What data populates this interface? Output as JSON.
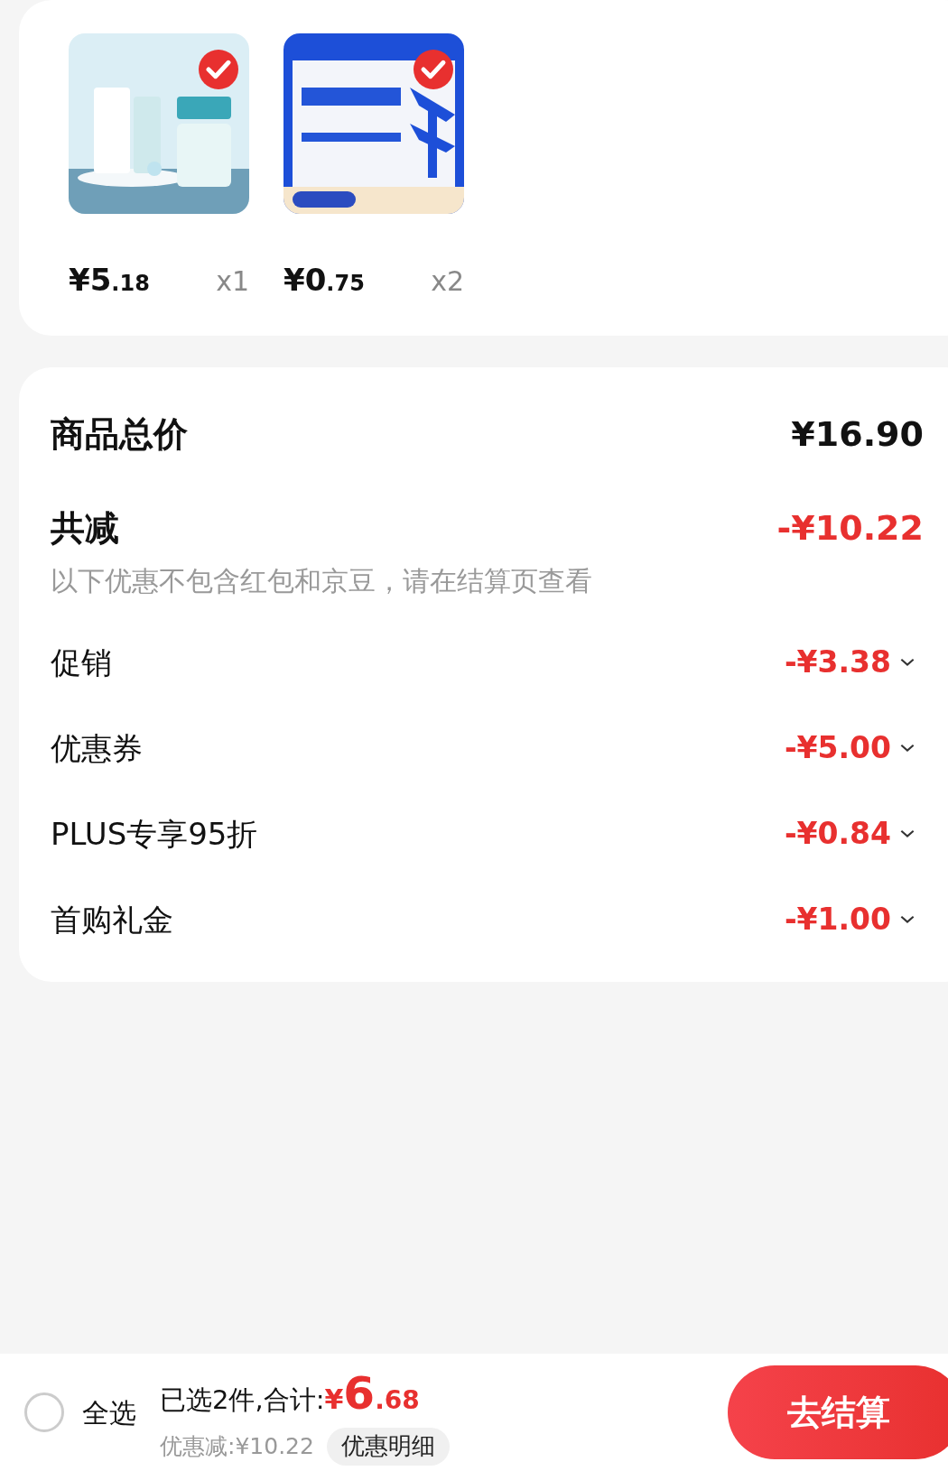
{
  "products": [
    {
      "selected": true,
      "price_main": "¥5",
      "price_decimal": ".18",
      "quantity": "x1"
    },
    {
      "selected": true,
      "price_main": "¥0",
      "price_decimal": ".75",
      "quantity": "x2"
    }
  ],
  "summary": {
    "total_label": "商品总价",
    "total_value": "¥16.90",
    "discount_label": "共减",
    "discount_value": "-¥10.22",
    "note": "以下优惠不包含红包和京豆，请在结算页查看",
    "items": [
      {
        "label": "促销",
        "value": "-¥3.38"
      },
      {
        "label": "优惠券",
        "value": "-¥5.00"
      },
      {
        "label": "PLUS专享95折",
        "value": "-¥0.84"
      },
      {
        "label": "首购礼金",
        "value": "-¥1.00"
      }
    ]
  },
  "bottom_bar": {
    "select_all": {
      "label": "全选",
      "checked": false
    },
    "selected_text": "已选2件,合计:",
    "currency": "¥",
    "total_main": "6",
    "total_decimal": ".68",
    "saved": "优惠减:¥10.22",
    "details_button": "优惠明细",
    "checkout_button": "去结算"
  }
}
